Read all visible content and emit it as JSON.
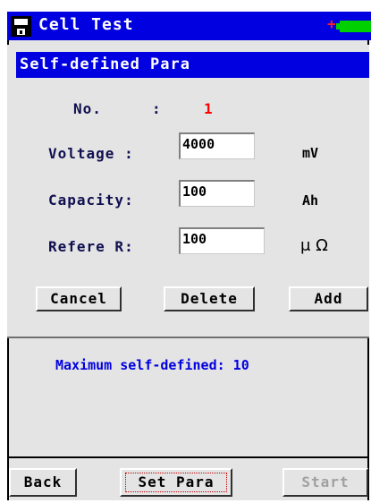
{
  "window": {
    "title": "Cell Test",
    "icon": "floppy-disk-icon",
    "battery_icon": "battery-charging-icon",
    "battery_color": "#00d000"
  },
  "dialog": {
    "title": "Self-defined Para",
    "no_label": "No.",
    "no_separator": ":",
    "no_value": "1",
    "voltage_label": "Voltage :",
    "voltage_value": "4000",
    "voltage_unit": "mV",
    "capacity_label": "Capacity:",
    "capacity_value": "100",
    "capacity_unit": "Ah",
    "refer_label": "Refere R:",
    "refer_value": "100",
    "refer_unit": "μ Ω",
    "buttons": {
      "cancel": "Cancel",
      "delete": "Delete",
      "add": "Add"
    }
  },
  "info_text": "Maximum self-defined: 10",
  "bottom_bar": {
    "back": "Back",
    "set_para": "Set Para",
    "start": "Start"
  },
  "colors": {
    "title_bar": "#0000e0",
    "no_value": "#ff0000",
    "info_text": "#0000e0",
    "disabled_text": "#a0a0a0"
  }
}
